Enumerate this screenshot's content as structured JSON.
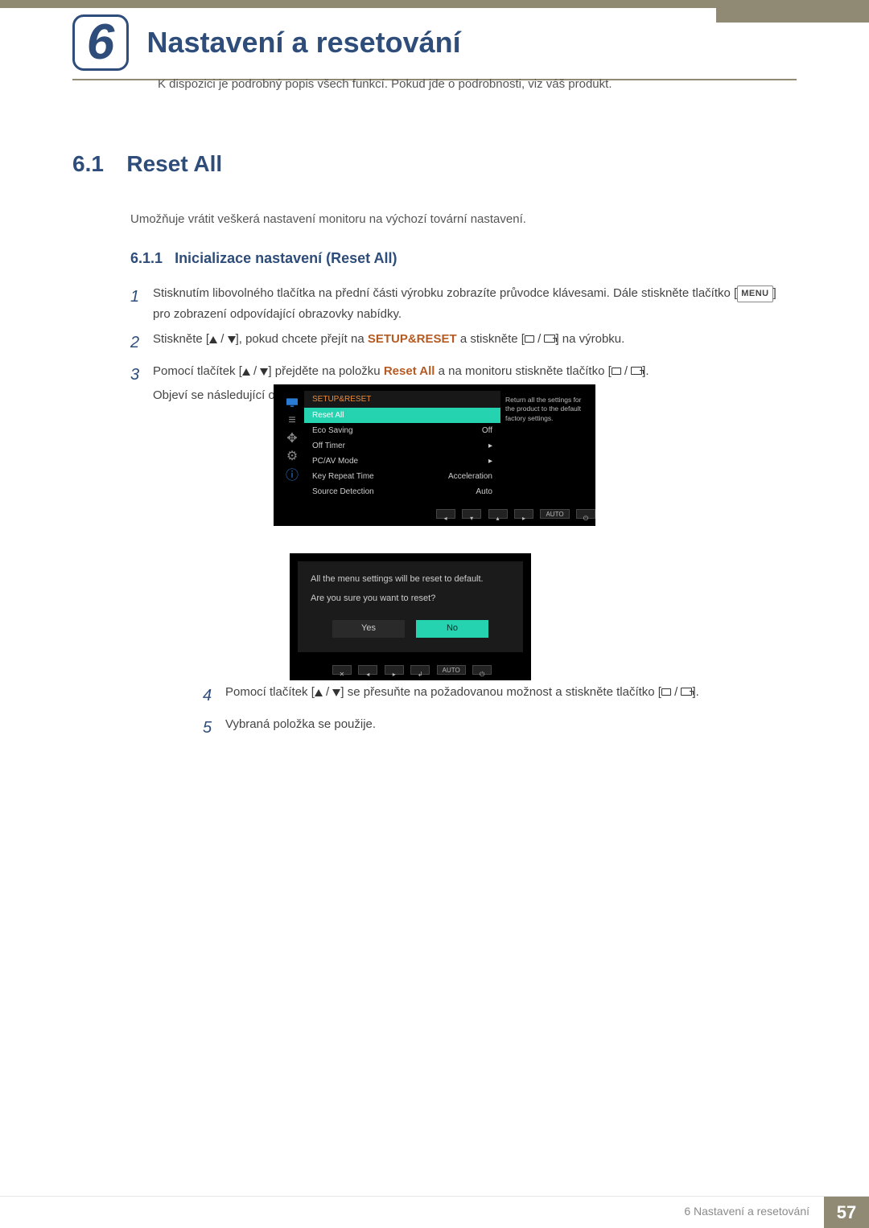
{
  "chapter": {
    "number": "6",
    "title": "Nastavení a resetování",
    "intro": "K dispozici je podrobný popis všech funkcí. Pokud jde o podrobnosti, viz váš produkt."
  },
  "section": {
    "num": "6.1",
    "title": "Reset All",
    "body": "Umožňuje vrátit veškerá nastavení monitoru na výchozí tovární nastavení."
  },
  "subsection": {
    "num": "6.1.1",
    "title": "Inicializace nastavení (Reset All)"
  },
  "steps": {
    "s1a": "Stisknutím libovolného tlačítka na přední části výrobku zobrazíte průvodce klávesami. Dále stiskněte tlačítko [",
    "s1_menu": "MENU",
    "s1b": "] pro zobrazení odpovídající obrazovky nabídky.",
    "s2a": "Stiskněte [",
    "s2b": "], pokud chcete přejít na ",
    "s2_bold": "SETUP&RESET",
    "s2c": " a stiskněte [",
    "s2d": "] na výrobku.",
    "s3a": "Pomocí tlačítek [",
    "s3b": "] přejděte na položku ",
    "s3_bold": "Reset All",
    "s3c": " a na monitoru stiskněte tlačítko [",
    "s3d": "].",
    "s3e": "Objeví se následující obrazovka.",
    "s4a": "Pomocí tlačítek [",
    "s4b": "] se přesuňte na požadovanou možnost a stiskněte tlačítko [",
    "s4c": "].",
    "s5": "Vybraná položka se použije."
  },
  "osd": {
    "title": "SETUP&RESET",
    "selected": "Reset All",
    "items": [
      {
        "label": "Eco Saving",
        "value": "Off"
      },
      {
        "label": "Off Timer",
        "value": "▸"
      },
      {
        "label": "PC/AV Mode",
        "value": "▸"
      },
      {
        "label": "Key Repeat Time",
        "value": "Acceleration"
      },
      {
        "label": "Source Detection",
        "value": "Auto"
      }
    ],
    "help": "Return all the settings for the product to the default factory settings.",
    "auto": "AUTO"
  },
  "dialog": {
    "line1": "All the menu settings will be reset to default.",
    "line2": "Are you sure you want to reset?",
    "yes": "Yes",
    "no": "No",
    "auto": "AUTO"
  },
  "footer": {
    "text": "6 Nastavení a resetování",
    "page": "57"
  }
}
